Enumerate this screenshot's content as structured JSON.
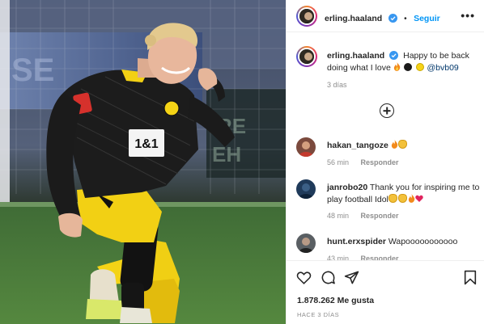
{
  "post": {
    "author": "erling.haaland",
    "follow_label": "Seguir",
    "dot": "•",
    "more": "•••",
    "caption_text": "Happy to be back doing what I love",
    "caption_mention": "@bvb09",
    "caption_time": "3 días",
    "jersey_sponsor": "1&1"
  },
  "comments": [
    {
      "user": "hakan_tangoze",
      "text": "",
      "time": "56 min",
      "reply": "Responder"
    },
    {
      "user": "janrobo20",
      "text": "Thank you for inspiring me to play football Idol",
      "time": "48 min",
      "reply": "Responder"
    },
    {
      "user": "hunt.erxspider",
      "text": "Wapooooooooooo",
      "time": "43 min",
      "reply": "Responder"
    }
  ],
  "actions": {
    "likes": "1.878.262 Me gusta",
    "date": "HACE 3 DÍAS"
  },
  "colors": {
    "link": "#0095f6",
    "mention": "#00376b",
    "muted": "#8e8e8e",
    "heart": "#ed4956"
  },
  "icons": [
    "verified-badge-icon",
    "more-options-icon",
    "add-comment-icon",
    "like-heart-icon",
    "comment-bubble-icon",
    "share-plane-icon",
    "save-bookmark-icon"
  ]
}
